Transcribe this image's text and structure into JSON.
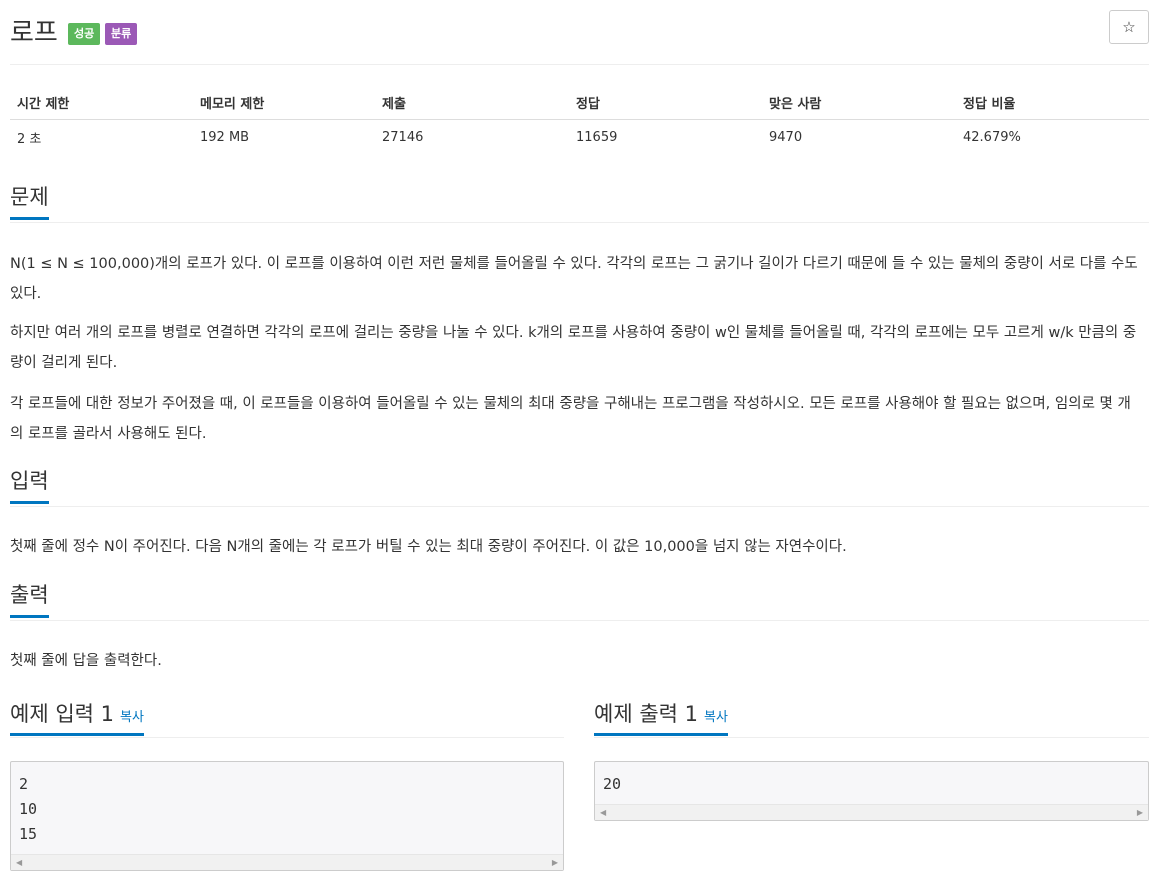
{
  "problem": {
    "title": "로프",
    "badges": {
      "success": "성공",
      "category": "분류"
    },
    "star_icon": "☆"
  },
  "info_table": {
    "headers": [
      "시간 제한",
      "메모리 제한",
      "제출",
      "정답",
      "맞은 사람",
      "정답 비율"
    ],
    "values": [
      "2 초",
      "192 MB",
      "27146",
      "11659",
      "9470",
      "42.679%"
    ]
  },
  "sections": {
    "problem": {
      "heading": "문제",
      "paragraphs": [
        "N(1 ≤ N ≤ 100,000)개의 로프가 있다. 이 로프를 이용하여 이런 저런 물체를 들어올릴 수 있다. 각각의 로프는 그 굵기나 길이가 다르기 때문에 들 수 있는 물체의 중량이 서로 다를 수도 있다.",
        "하지만 여러 개의 로프를 병렬로 연결하면 각각의 로프에 걸리는 중량을 나눌 수 있다. k개의 로프를 사용하여 중량이 w인 물체를 들어올릴 때, 각각의 로프에는 모두 고르게 w/k 만큼의 중량이 걸리게 된다.",
        "각 로프들에 대한 정보가 주어졌을 때, 이 로프들을 이용하여 들어올릴 수 있는 물체의 최대 중량을 구해내는 프로그램을 작성하시오. 모든 로프를 사용해야 할 필요는 없으며, 임의로 몇 개의 로프를 골라서 사용해도 된다."
      ]
    },
    "input": {
      "heading": "입력",
      "text": "첫째 줄에 정수 N이 주어진다. 다음 N개의 줄에는 각 로프가 버틸 수 있는 최대 중량이 주어진다. 이 값은 10,000을 넘지 않는 자연수이다."
    },
    "output": {
      "heading": "출력",
      "text": "첫째 줄에 답을 출력한다."
    }
  },
  "samples": {
    "input": {
      "heading": "예제 입력 1",
      "copy_label": "복사",
      "content": "2\n10\n15"
    },
    "output": {
      "heading": "예제 출력 1",
      "copy_label": "복사",
      "content": "20"
    }
  },
  "colors": {
    "success_badge": "#5cb85c",
    "category_badge": "#9b59b6",
    "accent": "#0076c0"
  }
}
